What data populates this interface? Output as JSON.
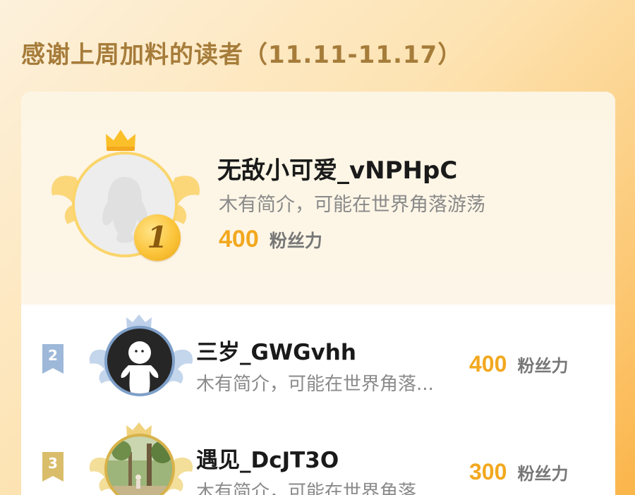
{
  "section": {
    "title": "感谢上周加料的读者（11.11-11.17）"
  },
  "readers": [
    {
      "rank": "1",
      "name": "无敌小可爱_vNPHpC",
      "bio": "木有简介，可能在世界角落游荡",
      "fans": "400",
      "fans_unit": "粉丝力",
      "avatar_icon": "default-penguin-icon"
    },
    {
      "rank": "2",
      "name": "三岁_GWGvhh",
      "bio": "木有简介，可能在世界角落...",
      "fans": "400",
      "fans_unit": "粉丝力",
      "avatar_icon": "white-figure-icon"
    },
    {
      "rank": "3",
      "name": "遇见_DcJT3O",
      "bio": "木有简介，可能在世界角落...",
      "fans": "300",
      "fans_unit": "粉丝力",
      "avatar_icon": "photo-avatar"
    }
  ],
  "colors": {
    "gold": "#f2a81f",
    "silver_blue": "#7e9fc8",
    "bronze": "#d8b24a",
    "title": "#a67c3a"
  }
}
